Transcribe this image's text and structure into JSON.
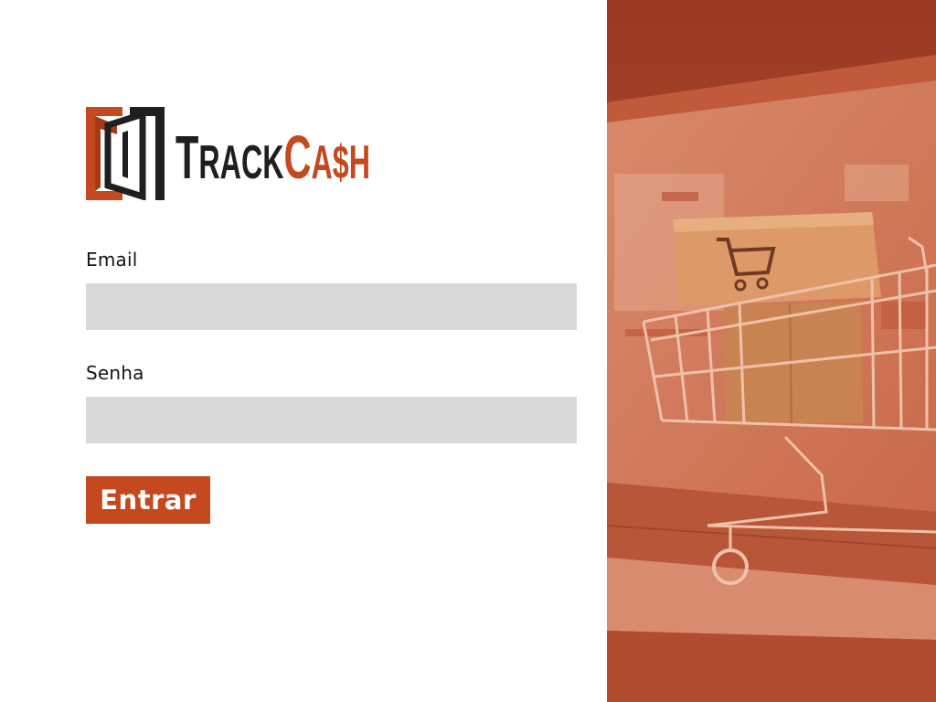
{
  "brand": {
    "word_dark": "TRACK",
    "word_accent": "CA$H",
    "logo_icon": "door-frame-logo-icon"
  },
  "form": {
    "email_label": "Email",
    "email_value": "",
    "password_label": "Senha",
    "password_value": "",
    "submit_label": "Entrar"
  },
  "hero": {
    "image": "shopping-cart-on-laptop-photo"
  },
  "colors": {
    "accent": "#c4491f",
    "input_background": "#d9d9d9",
    "text": "#151515",
    "hero_overlay": "#b4472b"
  }
}
